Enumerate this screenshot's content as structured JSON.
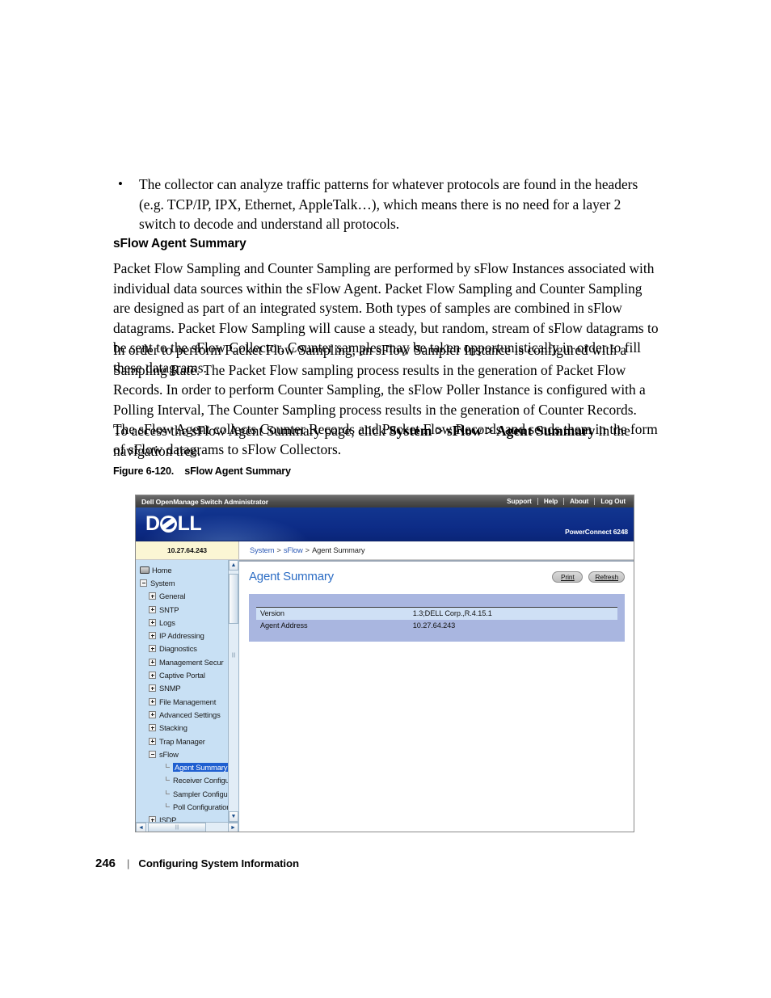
{
  "document": {
    "bullet": {
      "marker": "•",
      "text": "The collector can analyze traffic patterns for whatever protocols are found in the headers (e.g. TCP/IP, IPX, Ethernet, AppleTalk…), which means there is no need for a layer 2 switch to decode and understand all protocols."
    },
    "section_heading": "sFlow Agent Summary",
    "paragraph_1": "Packet Flow Sampling and Counter Sampling are performed by sFlow Instances associated with individual data sources within the sFlow Agent. Packet Flow Sampling and Counter Sampling are designed as part of an integrated system. Both types of samples are combined in sFlow datagrams. Packet Flow Sampling will cause a steady, but random, stream of sFlow datagrams to be sent to the sFlow Collector. Counter samples may be taken opportunistically in order to fill these datagrams.",
    "paragraph_2": "In order to perform Packet Flow Sampling, an sFlow Sampler Instance is configured with a Sampling Rate. The Packet Flow sampling process results in the generation of Packet Flow Records. In order to perform Counter Sampling, the sFlow Poller Instance is configured with a Polling Interval, The Counter Sampling process results in the generation of Counter Records. The sFlow Agent collects Counter Records and Packet Flow Records and sends them in the form of sFlow datagrams to sFlow Collectors.",
    "paragraph_3_prefix": "To access the sFlow Agent Summary page, click ",
    "paragraph_3_path_1": "System",
    "paragraph_3_sep_1": " > ",
    "paragraph_3_path_2": "sFlow",
    "paragraph_3_sep_2": " > ",
    "paragraph_3_path_3": "Agent Summary",
    "paragraph_3_suffix": " in the navigation tree.",
    "figure_caption": "Figure 6-120.    sFlow Agent Summary",
    "footer": {
      "page_number": "246",
      "separator": "|",
      "chapter": "Configuring System Information"
    }
  },
  "app": {
    "titlebar": {
      "title": "Dell OpenManage Switch Administrator",
      "links": [
        "Support",
        "Help",
        "About",
        "Log Out"
      ]
    },
    "brand": {
      "logo_pre": "D",
      "logo_post": "LL",
      "product": "PowerConnect 6248"
    },
    "crumb": {
      "ip_address": "10.27.64.243",
      "link_1": "System",
      "sep_1": ">",
      "link_2": "sFlow",
      "sep_2": ">",
      "current": "Agent Summary"
    },
    "tree": {
      "items": [
        {
          "label": "Home",
          "level": 0,
          "icon": "home",
          "expander": "none",
          "selected": false
        },
        {
          "label": "System",
          "level": 0,
          "icon": "expander",
          "expander": "minus",
          "selected": false
        },
        {
          "label": "General",
          "level": 1,
          "icon": "expander",
          "expander": "plus",
          "selected": false
        },
        {
          "label": "SNTP",
          "level": 1,
          "icon": "expander",
          "expander": "plus",
          "selected": false
        },
        {
          "label": "Logs",
          "level": 1,
          "icon": "expander",
          "expander": "plus",
          "selected": false
        },
        {
          "label": "IP Addressing",
          "level": 1,
          "icon": "expander",
          "expander": "plus",
          "selected": false
        },
        {
          "label": "Diagnostics",
          "level": 1,
          "icon": "expander",
          "expander": "plus",
          "selected": false
        },
        {
          "label": "Management Secur",
          "level": 1,
          "icon": "expander",
          "expander": "plus",
          "selected": false
        },
        {
          "label": "Captive Portal",
          "level": 1,
          "icon": "expander",
          "expander": "plus",
          "selected": false
        },
        {
          "label": "SNMP",
          "level": 1,
          "icon": "expander",
          "expander": "plus",
          "selected": false
        },
        {
          "label": "File Management",
          "level": 1,
          "icon": "expander",
          "expander": "plus",
          "selected": false
        },
        {
          "label": "Advanced Settings",
          "level": 1,
          "icon": "expander",
          "expander": "plus",
          "selected": false
        },
        {
          "label": "Stacking",
          "level": 1,
          "icon": "expander",
          "expander": "plus",
          "selected": false
        },
        {
          "label": "Trap Manager",
          "level": 1,
          "icon": "expander",
          "expander": "plus",
          "selected": false
        },
        {
          "label": "sFlow",
          "level": 1,
          "icon": "expander",
          "expander": "minus",
          "selected": false
        },
        {
          "label": "Agent Summary",
          "level": 2,
          "icon": "leaf",
          "expander": "none",
          "selected": true
        },
        {
          "label": "Receiver Configu",
          "level": 2,
          "icon": "leaf",
          "expander": "none",
          "selected": false
        },
        {
          "label": "Sampler Configu",
          "level": 2,
          "icon": "leaf",
          "expander": "none",
          "selected": false
        },
        {
          "label": "Poll Configuratior",
          "level": 2,
          "icon": "leaf",
          "expander": "none",
          "selected": false
        },
        {
          "label": "ISDP",
          "level": 1,
          "icon": "expander",
          "expander": "plus",
          "selected": false
        }
      ],
      "scroll_up_glyph": "▲",
      "scroll_down_glyph": "▼",
      "scroll_left_glyph": "◄",
      "scroll_right_glyph": "►",
      "thumb_grip": "|||"
    },
    "content": {
      "title": "Agent Summary",
      "buttons": [
        {
          "label": "Print"
        },
        {
          "label": "Refresh"
        }
      ],
      "rows": [
        {
          "label": "Version",
          "value": "1.3;DELL Corp.,R.4.15.1"
        },
        {
          "label": "Agent Address",
          "value": "10.27.64.243"
        }
      ]
    }
  },
  "colors": {
    "brand_blue": "#10308c",
    "titlebar_gray": "#4d4d4d",
    "tree_blue": "#c8e0f4",
    "selection_blue": "#1f5fd0",
    "card_purple": "#a9b6e0",
    "alt_row_blue": "#cfe0f5",
    "link_blue": "#2b59b6",
    "heading_blue": "#2b6cc4",
    "ip_yellow": "#fbf6d4"
  }
}
